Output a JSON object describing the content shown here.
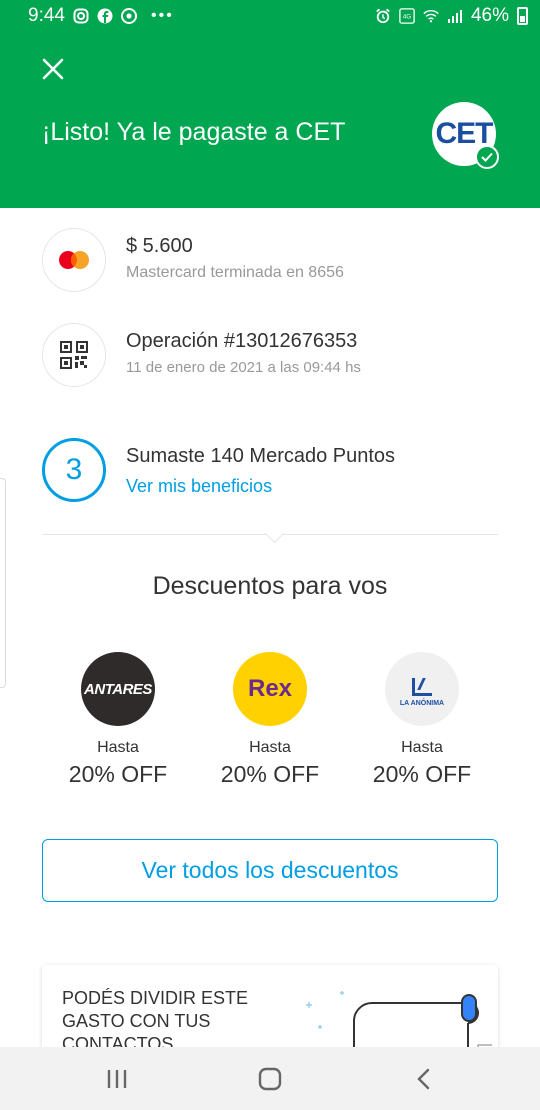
{
  "status_bar": {
    "time": "9:44",
    "dots": "•••",
    "battery_percent": "46%",
    "network_label": "VoLTE 4G"
  },
  "header": {
    "title": "¡Listo! Ya le pagaste a CET",
    "merchant_logo_text": "CET",
    "background_color": "#00a650"
  },
  "payment": {
    "amount": "$ 5.600",
    "card": "Mastercard terminada en 8656"
  },
  "operation": {
    "title": "Operación #13012676353",
    "date": "11 de enero de 2021 a las 09:44 hs"
  },
  "points": {
    "level": "3",
    "title": "Sumaste 140 Mercado Puntos",
    "link": "Ver mis beneficios"
  },
  "discounts": {
    "title": "Descuentos para vos",
    "items": [
      {
        "brand_icon": "antares-logo",
        "brand_text": "ANTARES",
        "upto": "Hasta",
        "off": "20% OFF"
      },
      {
        "brand_icon": "rex-logo",
        "brand_text": "Rex",
        "upto": "Hasta",
        "off": "20% OFF"
      },
      {
        "brand_icon": "la-anonima-logo",
        "brand_text": "LA ANÓNIMA",
        "upto": "Hasta",
        "off": "20% OFF"
      }
    ],
    "view_all_button": "Ver todos los descuentos"
  },
  "split_card": {
    "text": "PODÉS DIVIDIR ESTE GASTO CON TUS CONTACTOS"
  },
  "nav": {
    "icons": [
      "recent-apps-icon",
      "home-icon",
      "back-icon"
    ]
  },
  "colors": {
    "accent_blue": "#009ee3",
    "brand_green": "#00a650",
    "mastercard_red": "#eb001b",
    "mastercard_yellow": "#f79e1b"
  }
}
